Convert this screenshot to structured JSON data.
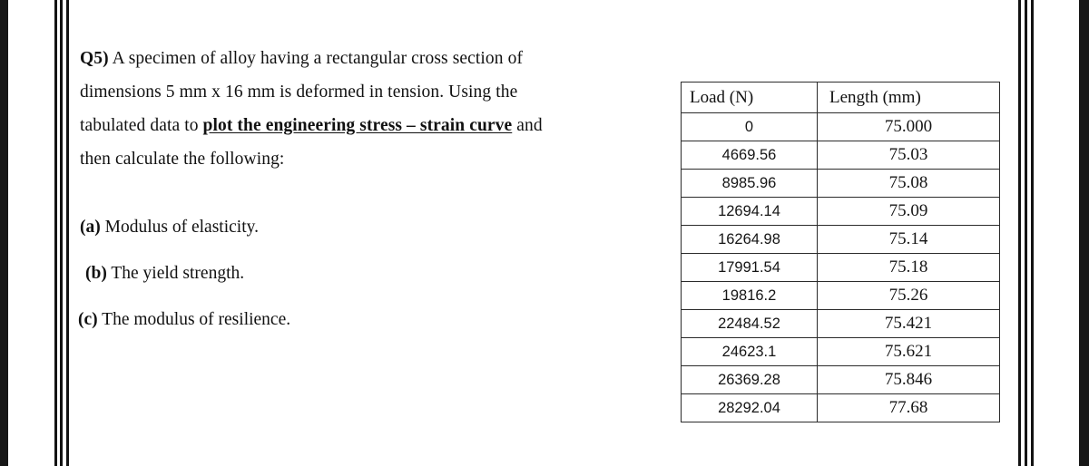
{
  "question": {
    "tag": "Q5)",
    "lines": [
      {
        "segments": [
          {
            "text": "Q5)",
            "style": "tag"
          },
          {
            "text": " A specimen of alloy having a rectangular cross section of",
            "style": "plain"
          }
        ]
      },
      {
        "segments": [
          {
            "text": "dimensions 5 mm x 16 mm is deformed in tension.  Using the",
            "style": "plain"
          }
        ]
      },
      {
        "segments": [
          {
            "text": "tabulated data to ",
            "style": "plain"
          },
          {
            "text": "plot the engineering stress – strain curve",
            "style": "emphasis"
          },
          {
            "text": " and",
            "style": "plain"
          }
        ]
      },
      {
        "segments": [
          {
            "text": "then calculate the following:",
            "style": "plain"
          }
        ]
      }
    ],
    "line_1_text": "Q5) A specimen of alloy having a rectangular cross section of",
    "line_2_text": "dimensions 5 mm x 16 mm is deformed in tension.  Using the",
    "line_3_prefix": "tabulated data to ",
    "line_3_emphasis": "plot the engineering stress – strain curve",
    "line_3_suffix": " and",
    "line_4_text": "then calculate the following:"
  },
  "sub_items": [
    {
      "marker": "(a)",
      "text": "  Modulus of elasticity."
    },
    {
      "marker": "(b)",
      "text": " The yield strength."
    },
    {
      "marker": "(c)",
      "text": " The modulus of resilience."
    }
  ],
  "table": {
    "headers": [
      "Load (N)",
      "Length (mm)"
    ],
    "rows": [
      {
        "load": "0",
        "length": "75.000"
      },
      {
        "load": "4669.56",
        "length": "75.03"
      },
      {
        "load": "8985.96",
        "length": "75.08"
      },
      {
        "load": "12694.14",
        "length": "75.09"
      },
      {
        "load": "16264.98",
        "length": "75.14"
      },
      {
        "load": "17991.54",
        "length": "75.18"
      },
      {
        "load": "19816.2",
        "length": "75.26"
      },
      {
        "load": "22484.52",
        "length": "75.421"
      },
      {
        "load": "24623.1",
        "length": "75.621"
      },
      {
        "load": "26369.28",
        "length": "75.846"
      },
      {
        "load": "28292.04",
        "length": "77.68"
      }
    ]
  },
  "page_artifacts": {
    "edge_color": "#171717",
    "rule_color": "#131313",
    "left_rules_x": [
      0,
      6,
      13
    ],
    "right_rules_x": [
      2,
      9,
      16
    ],
    "rule_width": 3
  }
}
